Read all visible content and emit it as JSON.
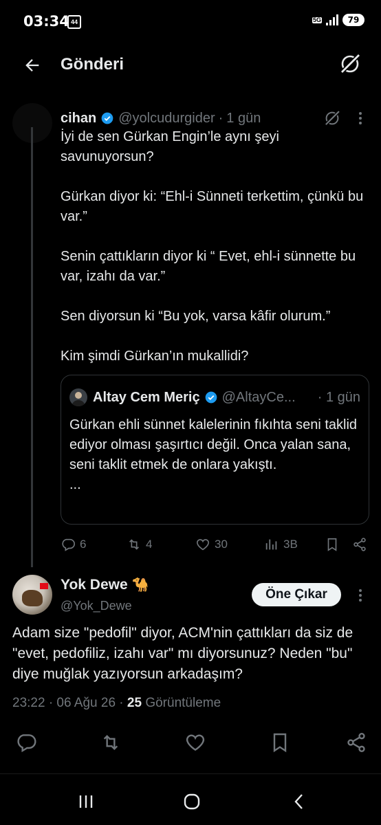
{
  "status_bar": {
    "time": "03:34",
    "notif_badge": "44",
    "network": "5G",
    "battery": "79"
  },
  "header": {
    "title": "Gönderi",
    "back_icon": "arrow-left-icon",
    "grok_icon": "grok-icon"
  },
  "parent_tweet": {
    "name": "cihan",
    "handle": "@yolcudurgider",
    "time": "1 gün",
    "paragraphs": [
      "İyi de sen Gürkan Engin’le aynı şeyi savunuyorsun?",
      "Gürkan diyor ki: “Ehl-i Sünneti terkettim, çünkü bu var.”",
      "Senin çattıkların diyor ki “ Evet, ehl-i sünnette bu var, izahı da var.”",
      "Sen diyorsun ki “Bu yok, varsa kâfir olurum.”",
      "Kim şimdi Gürkan’ın mukallidi?"
    ],
    "quote": {
      "name": "Altay Cem Meriç",
      "handle": "@AltayCe...",
      "time": "· 1 gün",
      "text": "Gürkan ehli sünnet kalelerinin fıkıhta seni taklid ediyor olması şaşırtıcı değil. Onca yalan sana, seni taklit etmek de onlara yakıştı.\n..."
    },
    "actions": {
      "replies": "6",
      "reposts": "4",
      "likes": "30",
      "views": "3B"
    }
  },
  "reply_tweet": {
    "name": "Yok Dewe",
    "name_emoji": "🐪",
    "handle": "@Yok_Dewe",
    "feature_button": "Öne Çıkar",
    "text": "Adam size \"pedofil\" diyor, ACM'nin çattıkları da siz de \"evet, pedofiliz, izahı var\" mı diyorsunuz? Neden \"bu\" diye muğlak yazıyorsun arkadaşım?",
    "time": "23:22 · 06 Ağu 26 ·",
    "views_count": "25",
    "views_label": "Görüntüleme"
  },
  "colors": {
    "background": "#000000",
    "text": "#e7e9ea",
    "muted": "#71767b",
    "verified": "#1d9bf0",
    "border": "#2f3336"
  }
}
